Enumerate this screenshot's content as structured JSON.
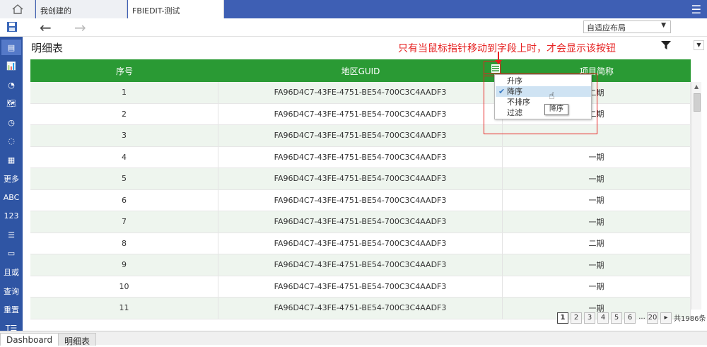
{
  "tabs": {
    "home_icon": "home-icon",
    "tab1": "我创建的",
    "tab2": "FBIEDIT-测试"
  },
  "toolbar": {
    "layout_value": "自适应布局"
  },
  "sidebar": [
    {
      "label": "▤",
      "icon": "table-layout-icon"
    },
    {
      "label": "📊",
      "icon": "bar-chart-icon"
    },
    {
      "label": "◔",
      "icon": "pie-chart-icon"
    },
    {
      "label": "🗺",
      "icon": "map-icon"
    },
    {
      "label": "◷",
      "icon": "gauge-icon"
    },
    {
      "label": "◌",
      "icon": "ring-chart-icon"
    },
    {
      "label": "▦",
      "icon": "grid-table-icon"
    },
    {
      "label": "更多",
      "icon": "more-icon"
    },
    {
      "label": "ABC",
      "icon": "text-icon"
    },
    {
      "label": "123",
      "icon": "number-icon"
    },
    {
      "label": "☰",
      "icon": "list-icon"
    },
    {
      "label": "▭",
      "icon": "date-icon"
    },
    {
      "label": "且或",
      "icon": "and-or-icon"
    },
    {
      "label": "查询",
      "icon": "query-icon"
    },
    {
      "label": "重置",
      "icon": "reset-icon"
    },
    {
      "label": "T☰",
      "icon": "text-list-icon"
    }
  ],
  "widget": {
    "title": "明细表",
    "annotation": "只有当鼠标指针移动到字段上时，才会显示该按钮",
    "columns": [
      "序号",
      "地区GUID",
      "项目简称"
    ],
    "rows": [
      [
        "1",
        "FA96D4C7-43FE-4751-BE54-700C3C4AADF3",
        "二期"
      ],
      [
        "2",
        "FA96D4C7-43FE-4751-BE54-700C3C4AADF3",
        "二期"
      ],
      [
        "3",
        "FA96D4C7-43FE-4751-BE54-700C3C4AADF3",
        ""
      ],
      [
        "4",
        "FA96D4C7-43FE-4751-BE54-700C3C4AADF3",
        "一期"
      ],
      [
        "5",
        "FA96D4C7-43FE-4751-BE54-700C3C4AADF3",
        "一期"
      ],
      [
        "6",
        "FA96D4C7-43FE-4751-BE54-700C3C4AADF3",
        "一期"
      ],
      [
        "7",
        "FA96D4C7-43FE-4751-BE54-700C3C4AADF3",
        "一期"
      ],
      [
        "8",
        "FA96D4C7-43FE-4751-BE54-700C3C4AADF3",
        "二期"
      ],
      [
        "9",
        "FA96D4C7-43FE-4751-BE54-700C3C4AADF3",
        "一期"
      ],
      [
        "10",
        "FA96D4C7-43FE-4751-BE54-700C3C4AADF3",
        "一期"
      ],
      [
        "11",
        "FA96D4C7-43FE-4751-BE54-700C3C4AADF3",
        "一期"
      ]
    ]
  },
  "sort_menu": {
    "asc": "升序",
    "desc": "降序",
    "none": "不排序",
    "filter": "过滤",
    "tooltip": "降序",
    "selected": "降序"
  },
  "pager": {
    "pages": [
      "1",
      "2",
      "3",
      "4",
      "5",
      "6"
    ],
    "ellipsis": "...",
    "last": "20",
    "next": "▸",
    "total": "共1986条"
  },
  "bottom_tabs": [
    "Dashboard",
    "明细表"
  ],
  "colors": {
    "header_green": "#2a9a34",
    "sidebar_blue": "#2f55a4",
    "top_blue": "#3e5fb4",
    "annotation_red": "#e62020"
  }
}
